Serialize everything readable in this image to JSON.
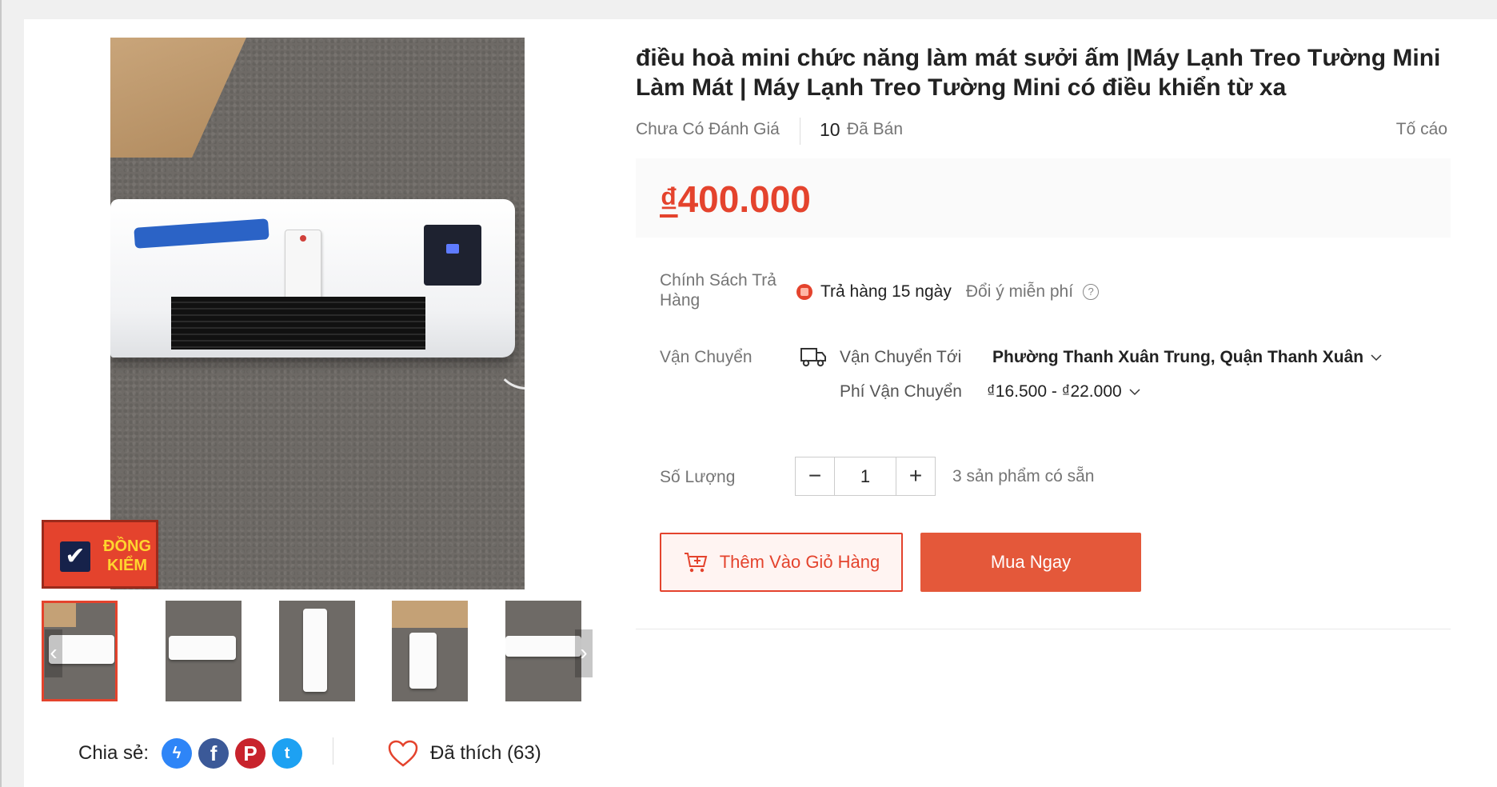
{
  "product": {
    "title": "điều hoà mini chức năng làm mát sưởi ấm |Máy Lạnh Treo Tường Mini Làm Mát | Máy Lạnh Treo Tường Mini có điều khiển từ xa",
    "rating_text": "Chưa Có Đánh Giá",
    "sold_count": "10",
    "sold_label": "Đã Bán",
    "report_label": "Tố cáo",
    "price_currency": "₫",
    "price_value": "400.000"
  },
  "badge": {
    "line1": "ĐỒNG",
    "line2": "KIỂM",
    "check": "✔"
  },
  "gallery": {
    "prev_glyph": "‹",
    "next_glyph": "›",
    "thumbnail_count": 5
  },
  "return_policy": {
    "label": "Chính Sách Trả Hàng",
    "main": "Trả hàng 15 ngày",
    "sub": "Đổi ý miễn phí",
    "help_glyph": "?"
  },
  "shipping": {
    "label": "Vận Chuyển",
    "to_label": "Vận Chuyển Tới",
    "to_value": "Phường Thanh Xuân Trung, Quận Thanh Xuân",
    "fee_label": "Phí Vận Chuyển",
    "fee_value": "₫16.500 - ₫22.000"
  },
  "quantity": {
    "label": "Số Lượng",
    "minus": "−",
    "value": "1",
    "plus": "+",
    "stock_text": "3 sản phẩm có sẵn"
  },
  "actions": {
    "add_to_cart": "Thêm Vào Giỏ Hàng",
    "buy_now": "Mua Ngay"
  },
  "share": {
    "label": "Chia sẻ:",
    "messenger_glyph": "ϟ",
    "facebook_glyph": "f",
    "pinterest_glyph": "P",
    "twitter_glyph": "t"
  },
  "likes": {
    "text": "Đã thích (63)"
  },
  "colors": {
    "accent": "#e4432d",
    "buy_button": "#e4583a",
    "badge_text": "#ffd52e",
    "badge_check_bg": "#16224a"
  }
}
